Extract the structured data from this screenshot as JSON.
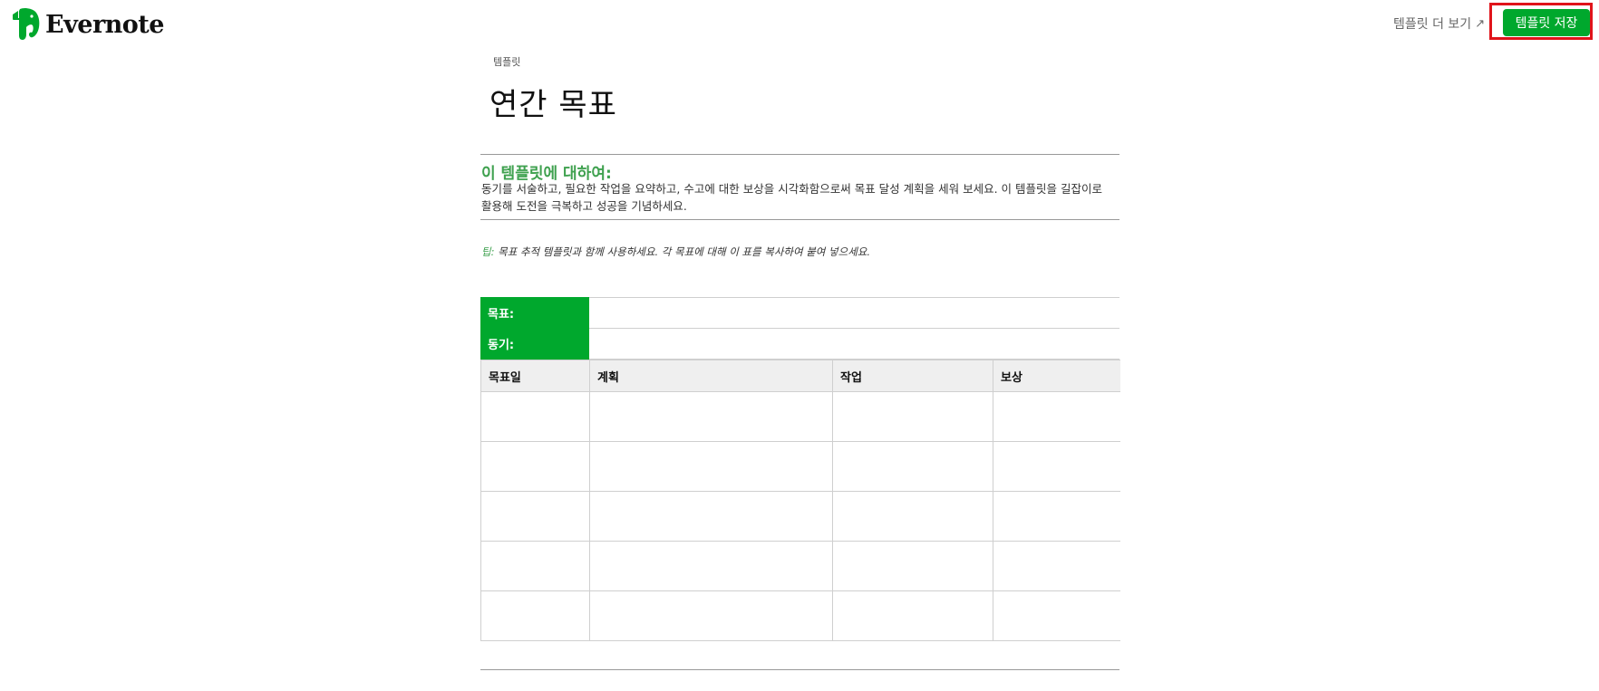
{
  "header": {
    "logo_text": "Evernote",
    "more_templates_label": "템플릿 더 보기",
    "more_templates_arrow": "↗",
    "save_button_label": "템플릿 저장",
    "brand_color": "#00a82d",
    "highlight_color": "#e0141b"
  },
  "doc": {
    "breadcrumb": "템플릿",
    "title": "연간 목표",
    "about_heading": "이 템플릿에 대하여:",
    "about_body": "동기를 서술하고, 필요한 작업을 요약하고, 수고에 대한 보상을 시각화함으로써 목표 달성 계획을 세워 보세요. 이 템플릿을 길잡이로 활용해 도전을 극복하고 성공을 기념하세요.",
    "tip_label": "팁:",
    "tip_text": " 목표 추적 템플릿과 함께 사용하세요. 각 목표에 대해 이 표를 복사하여 붙여 넣으세요."
  },
  "goal_table": {
    "goal_label": "목표:",
    "motivation_label": "동기:"
  },
  "plan_table": {
    "columns": [
      "목표일",
      "계획",
      "작업",
      "보상"
    ],
    "row_count": 5
  }
}
